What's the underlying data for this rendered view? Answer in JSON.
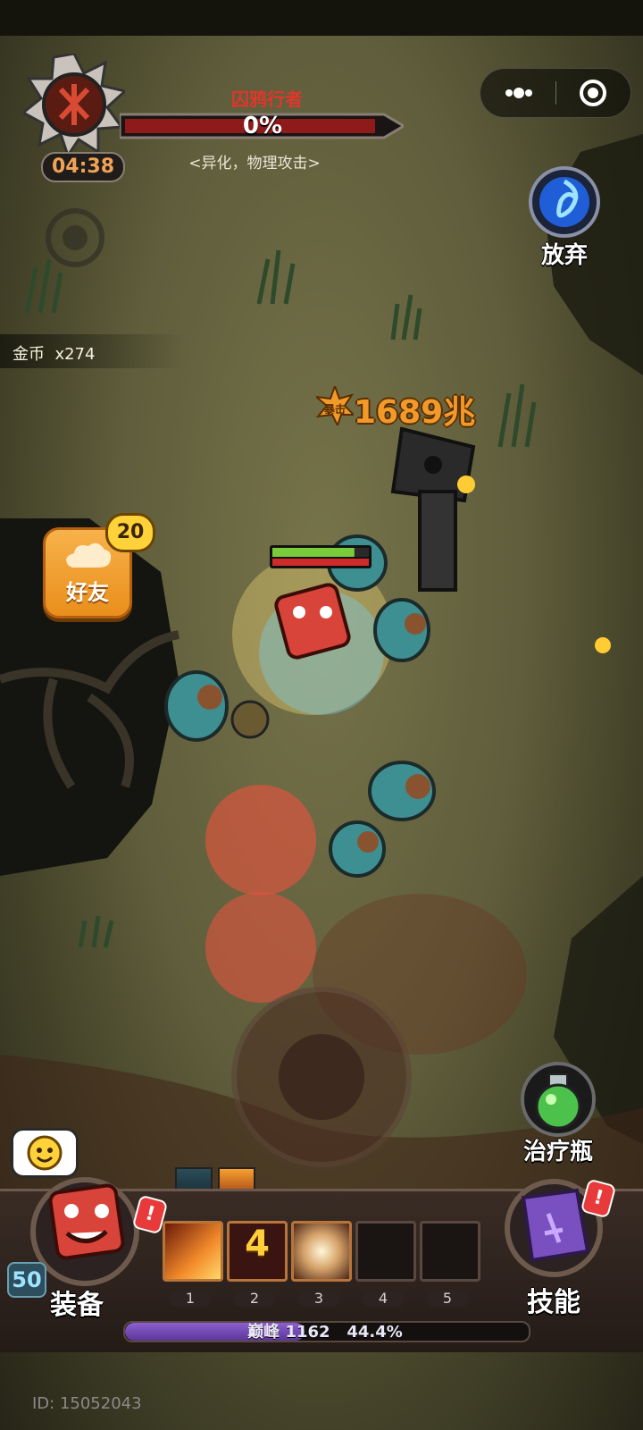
{
  "boss": {
    "name": "囚鸦行者",
    "hp_percent_label": "0%",
    "hp_fraction": 0.0,
    "traits": "<异化，物理攻击>",
    "timer": "04:38"
  },
  "capsule": {
    "more_icon": "more-dots-icon",
    "close_icon": "target-close-icon"
  },
  "top_right": {
    "giveup_label": "放弃"
  },
  "gold": {
    "label": "金币",
    "amount": "x274"
  },
  "friend": {
    "label": "好友",
    "badge_count": "20"
  },
  "combat": {
    "damage_prefix": "暴击",
    "damage_value": "1689兆",
    "hero_hp_fraction": 0.85
  },
  "heal": {
    "label": "治疗瓶"
  },
  "bottom": {
    "equip_label": "装备",
    "skill_label": "技能",
    "hero_level": "50",
    "alert_symbol": "!",
    "skill_slots": [
      {
        "number": "1",
        "content": ""
      },
      {
        "number": "2",
        "content": "4"
      },
      {
        "number": "3",
        "content": ""
      },
      {
        "number": "4",
        "content": ""
      },
      {
        "number": "5",
        "content": ""
      }
    ],
    "peak": {
      "label": "巅峰 1162",
      "percent_label": "44.4%",
      "fraction": 0.444
    }
  },
  "footer": {
    "player_id": "ID: 15052043"
  },
  "colors": {
    "boss_red": "#e0362c",
    "gold_orange": "#f19a2a",
    "peak_purple": "#7a4fc0",
    "friend_orange": "#f2a03a"
  }
}
